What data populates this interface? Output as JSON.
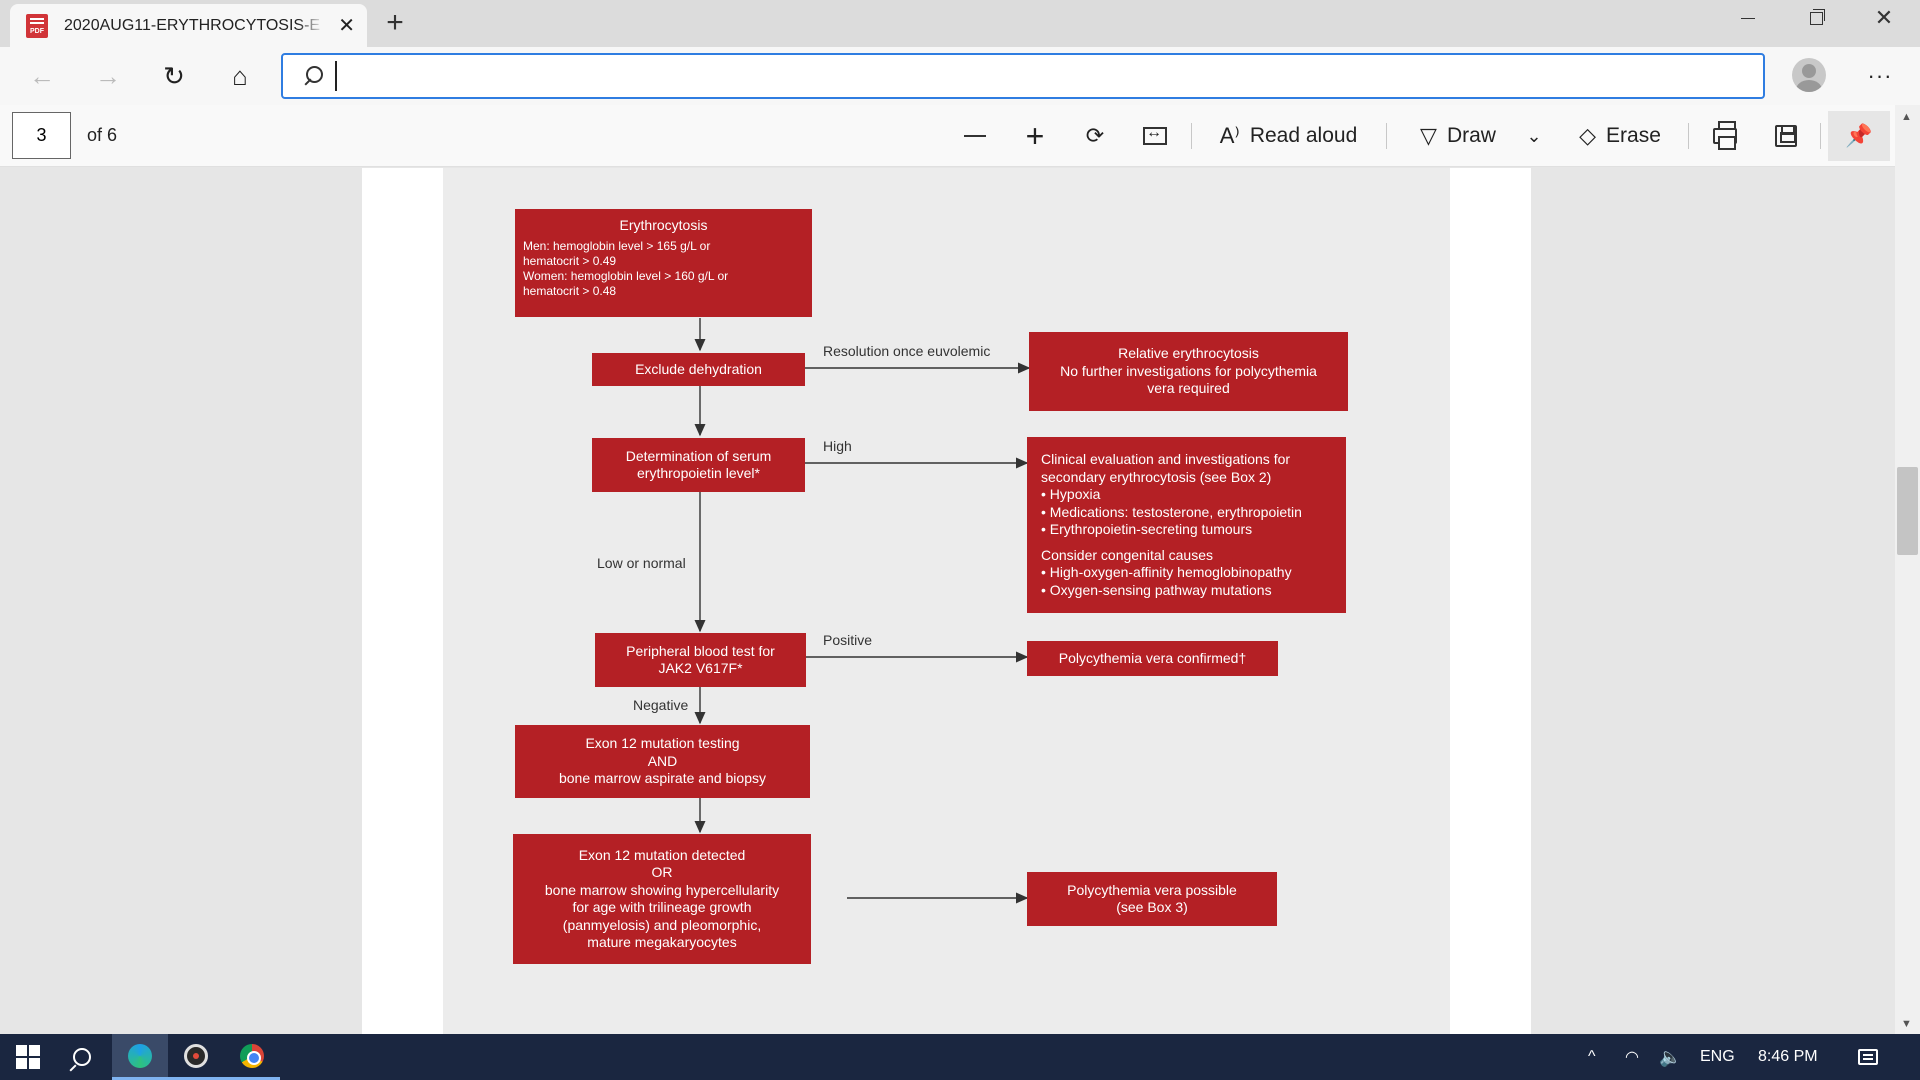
{
  "browser": {
    "tab": {
      "title": "2020AUG11-ERYTHROCYTOSIS-E",
      "pdf_icon_text": "PDF",
      "close_glyph": "✕"
    },
    "new_tab_glyph": "+",
    "window_controls": {
      "close_glyph": "✕"
    },
    "nav": {
      "back_glyph": "←",
      "forward_glyph": "→",
      "refresh_glyph": "↻",
      "home_glyph": "⌂"
    },
    "address_bar": {
      "value": "",
      "placeholder": ""
    },
    "more_glyph": "···"
  },
  "pdf_toolbar": {
    "page_current": "3",
    "page_total": "of 6",
    "zoom_in_glyph": "+",
    "rotate_glyph": "⟳",
    "read_aloud_label": "Read aloud",
    "read_aloud_glyph": "A⁾",
    "draw_label": "Draw",
    "draw_glyph": "▽",
    "draw_chevron_glyph": "⌄",
    "erase_label": "Erase",
    "erase_glyph": "◇",
    "pin_glyph": "📌"
  },
  "flowchart": {
    "erythrocytosis": {
      "title": "Erythrocytosis",
      "line1": "Men: hemoglobin level > 165 g/L or",
      "line2": "hematocrit > 0.49",
      "line3": "Women: hemoglobin level > 160 g/L or",
      "line4": "hematocrit > 0.48"
    },
    "exclude_dehydration": "Exclude dehydration",
    "resolution_label": "Resolution once euvolemic",
    "relative": {
      "line1": "Relative erythrocytosis",
      "line2": "No further investigations for polycythemia",
      "line3": "vera required"
    },
    "epo": {
      "line1": "Determination of serum",
      "line2": "erythropoietin level*"
    },
    "high_label": "High",
    "clinical": {
      "line1": "Clinical evaluation and investigations for",
      "line2": "secondary erythrocytosis (see Box 2)",
      "item1": "• Hypoxia",
      "item2": "• Medications: testosterone, erythropoietin",
      "item3": "• Erythropoietin-secreting tumours",
      "line3": "Consider congenital causes",
      "item4": "• High-oxygen-affinity hemoglobinopathy",
      "item5": "• Oxygen-sensing pathway mutations"
    },
    "low_normal_label": "Low or normal",
    "jak2": {
      "line1": "Peripheral blood test for",
      "line2": "JAK2 V617F*"
    },
    "positive_label": "Positive",
    "pv_confirmed": "Polycythemia vera confirmed†",
    "negative_label": "Negative",
    "exon_testing": {
      "line1": "Exon 12 mutation testing",
      "line2": "AND",
      "line3": "bone marrow aspirate and biopsy"
    },
    "exon_detected": {
      "line1": "Exon 12 mutation detected",
      "line2": "OR",
      "line3": "bone marrow showing hypercellularity",
      "line4": "for age with trilineage growth",
      "line5": "(panmyelosis) and pleomorphic,",
      "line6": "mature megakaryocytes"
    },
    "pv_possible": {
      "line1": "Polycythemia vera possible",
      "line2": "(see Box 3)"
    }
  },
  "scrollbar": {
    "up_glyph": "▲",
    "down_glyph": "▼"
  },
  "taskbar": {
    "tray_chevron_glyph": "^",
    "network_glyph": "◠",
    "volume_glyph": "🔈",
    "language": "ENG",
    "clock": "8:46 PM"
  },
  "colors": {
    "flow_red": "#b42025",
    "accent": "#2f7de1",
    "taskbar": "#1a2640"
  }
}
